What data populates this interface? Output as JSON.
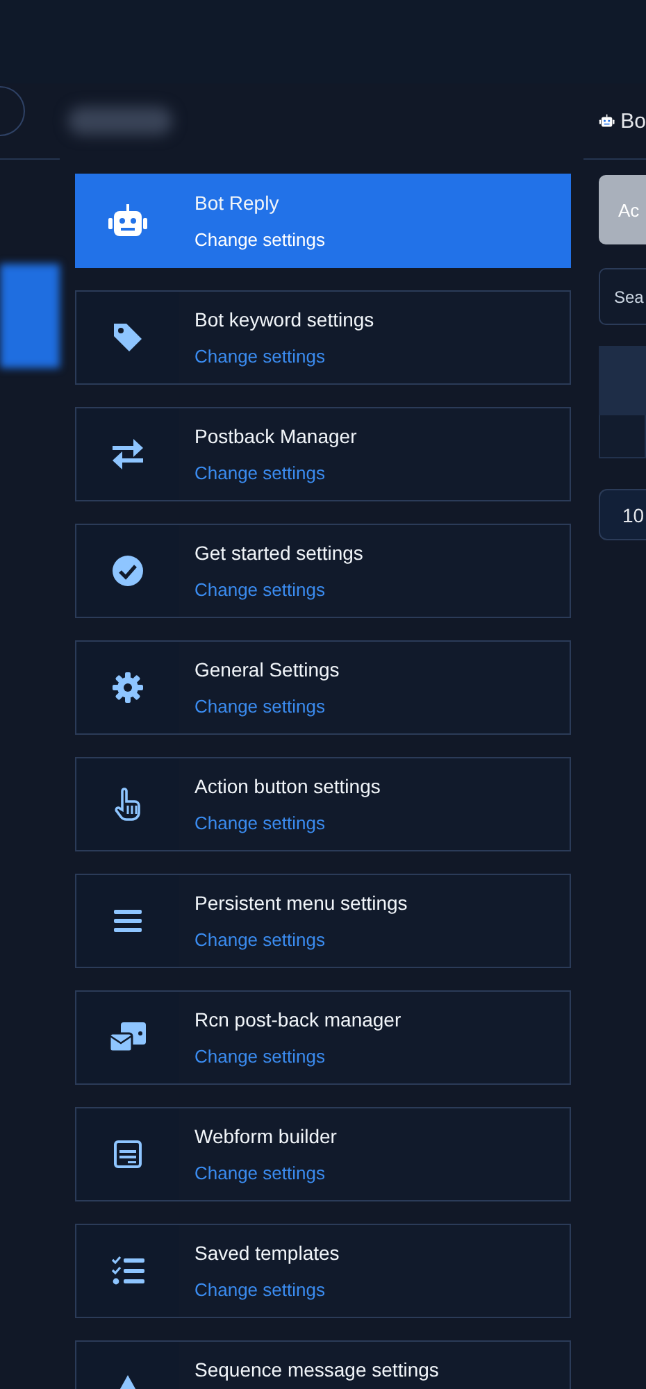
{
  "header": {
    "bot_label": "Bo"
  },
  "menu": [
    {
      "kind": "robot",
      "title": "Bot Reply",
      "link": "Change settings",
      "selected": true
    },
    {
      "kind": "tag",
      "title": "Bot keyword settings",
      "link": "Change settings",
      "selected": false
    },
    {
      "kind": "swap",
      "title": "Postback Manager",
      "link": "Change settings",
      "selected": false
    },
    {
      "kind": "check",
      "title": "Get started settings",
      "link": "Change settings",
      "selected": false
    },
    {
      "kind": "gear",
      "title": "General Settings",
      "link": "Change settings",
      "selected": false
    },
    {
      "kind": "hand",
      "title": "Action button settings",
      "link": "Change settings",
      "selected": false
    },
    {
      "kind": "bars",
      "title": "Persistent menu settings",
      "link": "Change settings",
      "selected": false
    },
    {
      "kind": "envelope",
      "title": "Rcn post-back manager",
      "link": "Change settings",
      "selected": false
    },
    {
      "kind": "form",
      "title": "Webform builder",
      "link": "Change settings",
      "selected": false
    },
    {
      "kind": "checklist",
      "title": "Saved templates",
      "link": "Change settings",
      "selected": false
    },
    {
      "kind": "triangle",
      "title": "Sequence message settings",
      "selected": false
    }
  ],
  "right_panel": {
    "button": "Ac",
    "search_placeholder": "Sea",
    "page_size": "10"
  }
}
